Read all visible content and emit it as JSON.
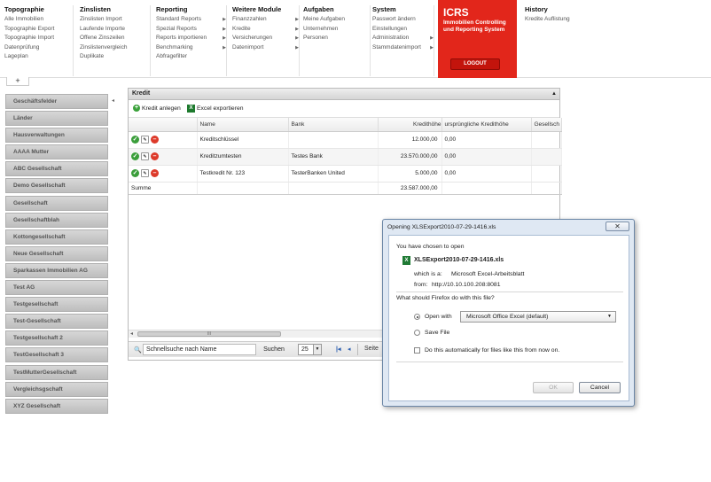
{
  "nav": [
    {
      "title": "Topographie",
      "items": [
        "Alle Immobilien",
        "Topographie Export",
        "Topographie Import",
        "Datenprüfung",
        "Lageplan"
      ],
      "arrows": []
    },
    {
      "title": "Zinslisten",
      "items": [
        "Zinslisten Import",
        "Laufende Importe",
        "Offene Zinszeilen",
        "Zinslistenvergleich",
        "Duplikate"
      ],
      "arrows": []
    },
    {
      "title": "Reporting",
      "items": [
        "Standard Reports",
        "Spezial Reports",
        "Reports importieren",
        "Benchmarking",
        "Abfragefilter"
      ],
      "arrows": [
        0,
        1,
        2,
        3
      ]
    },
    {
      "title": "Weitere Module",
      "items": [
        "Finanzzahlen",
        "Kredite",
        "Versicherungen",
        "Datenimport"
      ],
      "arrows": [
        0,
        1,
        2,
        3
      ]
    },
    {
      "title": "Aufgaben",
      "items": [
        "Meine Aufgaben",
        "Unternehmen",
        "Personen"
      ],
      "arrows": []
    },
    {
      "title": "System",
      "items": [
        "Passwort ändern",
        "Einstellungen",
        "Administration",
        "Stammdatenimport"
      ],
      "arrows": [
        2,
        3
      ]
    },
    {
      "title": "History",
      "items": [
        "Kredite Auflistung"
      ],
      "arrows": []
    }
  ],
  "brand": {
    "title": "ICRS",
    "subtitle": "Immobilien Controlling und Reporting System",
    "logout": "LOGOUT",
    "color": "#e2261b"
  },
  "add_tab": "+",
  "sidebar": [
    "Geschäftsfelder",
    "Länder",
    "Hausverwaltungen",
    "AAAA Mutter",
    "ABC Gesellschaft",
    "Demo Gesellschaft",
    "Gesellschaft",
    "Gesellschaftblah",
    "Kottongesellschaft",
    "Neue Gesellschaft",
    "Sparkassen Immobilien AG",
    "Test AG",
    "Testgesellschaft",
    "Test-Gesellschaft",
    "Testgesellschaft 2",
    "TestGesellschaft 3",
    "TestMutterGesellschaft",
    "Vergleichsgschaft",
    "XYZ Gesellschaft"
  ],
  "panel": {
    "title": "Kredit",
    "add_label": "Kredit anlegen",
    "export_label": "Excel exportieren",
    "columns": [
      "",
      "Name",
      "Bank",
      "Kredithöhe",
      "ursprüngliche Kredithöhe",
      "Gesellsch"
    ],
    "rows": [
      {
        "name": "Kreditschlüssel",
        "bank": "",
        "amount": "12.000,00",
        "orig": "0,00"
      },
      {
        "name": "Kreditzumtesten",
        "bank": "Testes Bank",
        "amount": "23.570.000,00",
        "orig": "0,00"
      },
      {
        "name": "Testkredit Nr. 123",
        "bank": "TesterBanken United",
        "amount": "5.000,00",
        "orig": "0,00"
      }
    ],
    "sum_label": "Summe",
    "sum_value": "23.587.000,00",
    "scroll_grip": "III",
    "search_placeholder": "Schnellsuche nach Name",
    "search_button": "Suchen",
    "page_size": "25",
    "page_label": "Seite"
  },
  "dialog": {
    "title": "Opening XLSExport2010-07-29-1416.xls",
    "chosen": "You have chosen to open",
    "filename": "XLSExport2010-07-29-1416.xls",
    "which_is_label": "which is a:",
    "which_is_value": "Microsoft Excel-Arbeitsblatt",
    "from_label": "from:",
    "from_value": "http://10.10.100.208:8081",
    "question": "What should Firefox do with this file?",
    "open_with": "Open with",
    "app": "Microsoft Office Excel (default)",
    "save": "Save File",
    "auto": "Do this automatically for files like this from now on.",
    "ok": "OK",
    "cancel": "Cancel"
  }
}
